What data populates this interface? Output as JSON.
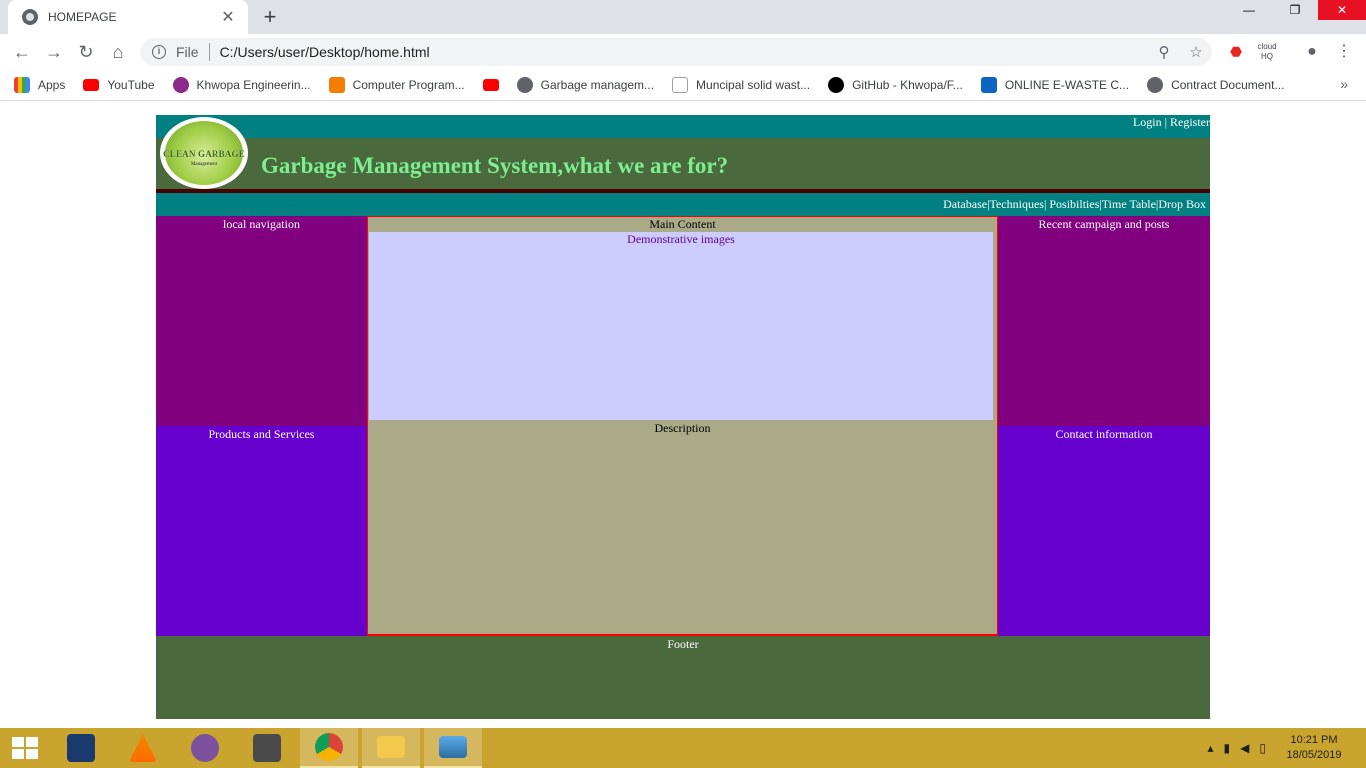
{
  "browser": {
    "tab_title": "HOMEPAGE",
    "new_tab": "+",
    "file_label": "File",
    "url": "C:/Users/user/Desktop/home.html",
    "bookmarks": [
      {
        "label": "Apps"
      },
      {
        "label": "YouTube"
      },
      {
        "label": "Khwopa Engineerin..."
      },
      {
        "label": "Computer Program..."
      },
      {
        "label": ""
      },
      {
        "label": "Garbage managem..."
      },
      {
        "label": "Muncipal solid wast..."
      },
      {
        "label": "GitHub - Khwopa/F..."
      },
      {
        "label": "ONLINE E-WASTE C..."
      },
      {
        "label": "Contract Document..."
      }
    ],
    "more": "»"
  },
  "page": {
    "login": "Login | Register",
    "logo_text": "CLEAN GARBAGE",
    "logo_sub": "Management",
    "title": "Garbage Management System,what we are for?",
    "nav": "Database|Techniques| Posibilties|Time Table|Drop Box",
    "left_top": "local navigation",
    "left_bottom": "Products and Services",
    "main_title": "Main Content",
    "demo": "Demonstrative images",
    "description": "Description",
    "right_top": "Recent campaign and posts",
    "right_bottom": "Contact information",
    "footer": "Footer"
  },
  "taskbar": {
    "time": "10:21 PM",
    "date": "18/05/2019"
  },
  "colors": {
    "teal": "#008080",
    "olive": "#4a6a3d",
    "purple": "#800080",
    "violet": "#6600cc",
    "khaki": "#aaaa88",
    "lavender": "#ccccff",
    "title_green": "#7cf090"
  }
}
